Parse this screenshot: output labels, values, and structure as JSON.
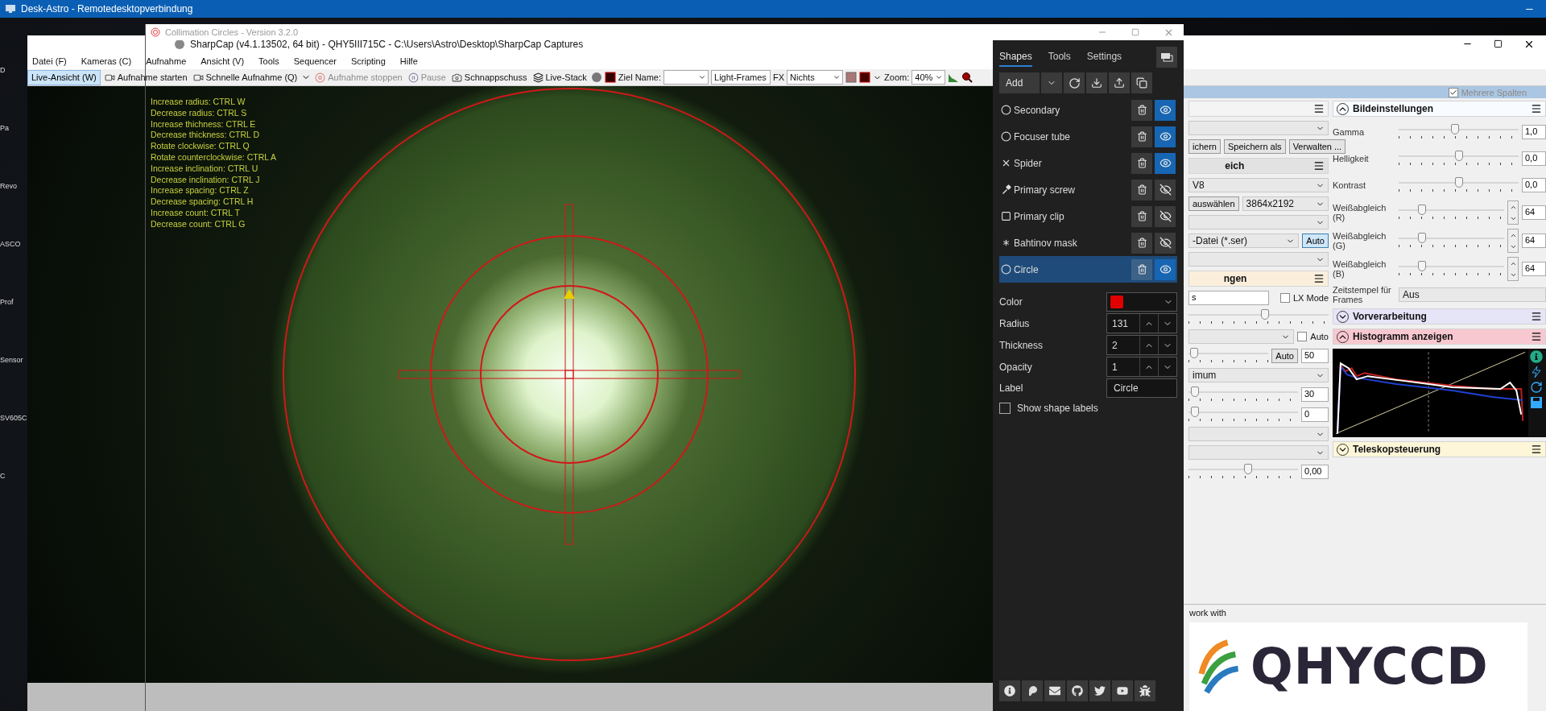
{
  "remote_window": {
    "title": "Desk-Astro - Remotedesktopverbindung"
  },
  "desktop_icons": [
    {
      "label": "D"
    },
    {
      "label": "Pa"
    },
    {
      "label": "Revo"
    },
    {
      "label": "ASCO"
    },
    {
      "label": "Prof"
    },
    {
      "label": "Sensor"
    },
    {
      "label": "SV605C"
    },
    {
      "label": "C"
    }
  ],
  "sharpcap": {
    "title": "SharpCap (v4.1.13502, 64 bit) - QHY5III715C - C:\\Users\\Astro\\Desktop\\SharpCap Captures",
    "menu": [
      "Datei (F)",
      "Kameras (C)",
      "Aufnahme",
      "Ansicht (V)",
      "Tools",
      "Sequencer",
      "Scripting",
      "Hilfe"
    ],
    "toolbar": {
      "live_view": {
        "label": "Live-Ansicht (W)",
        "selected": true
      },
      "actions": [
        {
          "kind": "capture",
          "label": "Aufnahme starten",
          "disabled": false
        },
        {
          "kind": "quick",
          "label": "Schnelle Aufnahme (Q)",
          "disabled": false
        },
        {
          "kind": "stop",
          "label": "Aufnahme stoppen",
          "disabled": true
        },
        {
          "kind": "pause",
          "label": "Pause",
          "disabled": true
        },
        {
          "kind": "snapshot",
          "label": "Schnappschuss",
          "disabled": false
        },
        {
          "kind": "stack",
          "label": "Live-Stack",
          "disabled": false
        }
      ],
      "target_label": "Ziel Name:",
      "frame_type": "Light-Frames",
      "fx_label": "FX",
      "fx_value": "Nichts",
      "zoom_label": "Zoom:",
      "zoom_value": "40%"
    },
    "columns_option": {
      "label": "Mehrere Spalten",
      "checked": true
    },
    "left_column": [
      {
        "kind": "header",
        "color": "#f4f4f4"
      },
      {
        "kind": "select"
      },
      {
        "kind": "buttons",
        "buttons": [
          "ichern",
          "Speichern als",
          "Verwalten ..."
        ]
      },
      {
        "kind": "header",
        "title": "eich",
        "color": "#e2e2e2"
      },
      {
        "kind": "select",
        "value": "V8"
      },
      {
        "kind": "button_select",
        "button": "auswählen",
        "value": "3864x2192"
      },
      {
        "kind": "select"
      },
      {
        "kind": "select_button",
        "value": "-Datei (*.ser)",
        "button": "Auto",
        "selected": true
      },
      {
        "kind": "select"
      },
      {
        "kind": "header",
        "title": "ngen",
        "color": "#fbefdc"
      },
      {
        "kind": "field_check",
        "value": "s",
        "label": "LX Mode",
        "checked": false
      },
      {
        "kind": "slider",
        "level": 0.55
      },
      {
        "kind": "select_check",
        "label": "Auto",
        "checked": false
      },
      {
        "kind": "slider_auto",
        "level": 0.02,
        "button": "Auto",
        "value": "50"
      },
      {
        "kind": "select",
        "value": "imum"
      },
      {
        "kind": "slider",
        "level": 0.02,
        "value": "30"
      },
      {
        "kind": "slider",
        "level": 0.02,
        "value": "0"
      },
      {
        "kind": "select"
      },
      {
        "kind": "select"
      },
      {
        "kind": "slider",
        "level": 0.55,
        "value": "0,00"
      }
    ],
    "sections": [
      {
        "kind": "image_settings",
        "title": "Bildeinstellungen",
        "expanded": true,
        "color": "#f8fbff",
        "sliders": [
          {
            "kind": "plain",
            "label": "Gamma",
            "level": 0.47,
            "value": "1,0"
          },
          {
            "kind": "plain",
            "label": "Helligkeit",
            "level": 0.5,
            "value": "0,0"
          },
          {
            "kind": "plain",
            "label": "Kontrast",
            "level": 0.5,
            "value": "0,0"
          },
          {
            "kind": "spinner",
            "label": "Weißabgleich (R)",
            "level": 0.2,
            "value": "64"
          },
          {
            "kind": "spinner",
            "label": "Weißabgleich (G)",
            "level": 0.2,
            "value": "64"
          },
          {
            "kind": "spinner",
            "label": "Weißabgleich (B)",
            "level": 0.2,
            "value": "64"
          }
        ],
        "timestamp": {
          "label": "Zeitstempel für Frames",
          "value": "Aus"
        }
      },
      {
        "kind": "plain",
        "title": "Vorverarbeitung",
        "expanded": false,
        "color": "#e6e4f7"
      },
      {
        "kind": "histogram",
        "title": "Histogramm anzeigen",
        "expanded": true,
        "color": "#f8c8d0"
      },
      {
        "kind": "plain",
        "title": "Teleskopsteuerung",
        "expanded": false,
        "color": "#fdf6d8"
      }
    ],
    "sponsor": {
      "text": "work with",
      "logo_text": "QHYCCD"
    }
  },
  "collimation": {
    "title": "Collimation Circles - Version 3.2.0",
    "hints": [
      "Increase radius: CTRL W",
      "Decrease radius: CTRL S",
      "Increase thichness: CTRL E",
      "Decrease thickness: CTRL D",
      "Rotate clockwise: CTRL Q",
      "Rotate counterclockwise: CTRL A",
      "Increase inclination: CTRL U",
      "Decrease inclination: CTRL J",
      "Increase spacing: CTRL Z",
      "Decrease spacing: CTRL H",
      "Increase count: CTRL T",
      "Decrease count: CTRL G"
    ],
    "tabs": [
      {
        "label": "Shapes",
        "selected": true
      },
      {
        "label": "Tools",
        "selected": false
      },
      {
        "label": "Settings",
        "selected": false
      }
    ],
    "add_label": "Add",
    "shapes": [
      {
        "name": "Secondary",
        "kind": "circle",
        "visible": true,
        "selected": false
      },
      {
        "name": "Focuser tube",
        "kind": "circle",
        "visible": true,
        "selected": false
      },
      {
        "name": "Spider",
        "kind": "cross",
        "visible": true,
        "selected": false
      },
      {
        "name": "Primary screw",
        "kind": "screw",
        "visible": false,
        "selected": false
      },
      {
        "name": "Primary clip",
        "kind": "square",
        "visible": false,
        "selected": false
      },
      {
        "name": "Bahtinov mask",
        "kind": "asterisk",
        "visible": false,
        "selected": false
      },
      {
        "name": "Circle",
        "kind": "circle",
        "visible": true,
        "selected": true
      }
    ],
    "color": {
      "label": "Color",
      "color": "#e00000"
    },
    "numbers": [
      {
        "label": "Radius",
        "value": "131"
      },
      {
        "label": "Thickness",
        "value": "2"
      },
      {
        "label": "Opacity",
        "value": "1"
      }
    ],
    "label_field": {
      "label": "Label",
      "value": "Circle"
    },
    "show_labels": {
      "label": "Show shape labels",
      "checked": false
    }
  }
}
